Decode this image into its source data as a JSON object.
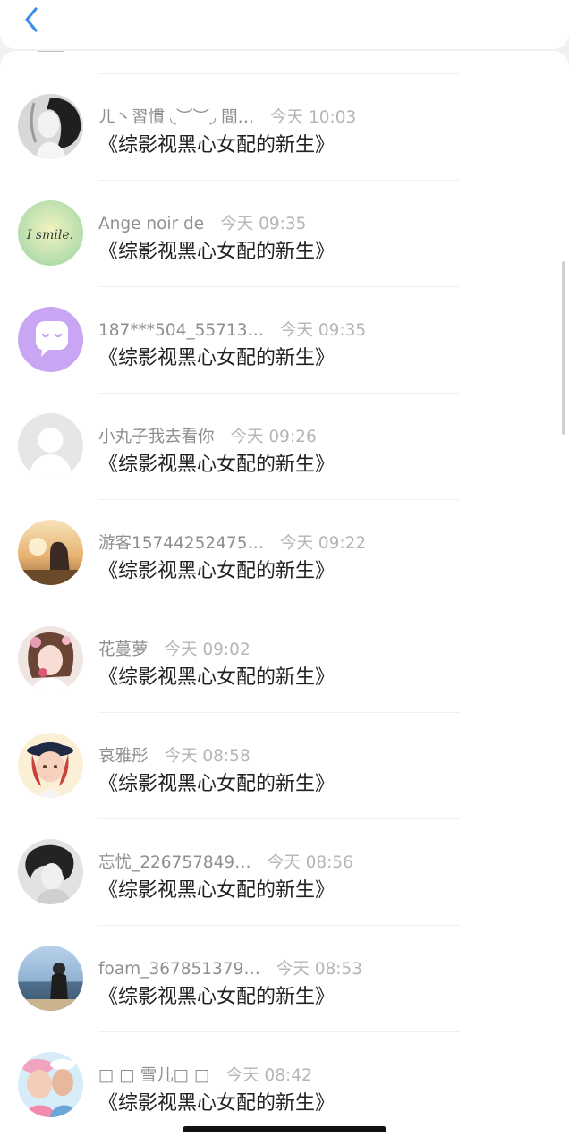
{
  "nav": {
    "back_icon": "chevron-left-icon",
    "accent": "#3a8ee6"
  },
  "comments": [
    {
      "name": "ㄦ丶習慣 ◟︶︶◞ 間…",
      "time": "今天 10:03",
      "text": "《综影视黑心女配的新生》"
    },
    {
      "name": "Ange noir de",
      "time": "今天 09:35",
      "text": "《综影视黑心女配的新生》"
    },
    {
      "name": "187***504_55713…",
      "time": "今天 09:35",
      "text": "《综影视黑心女配的新生》"
    },
    {
      "name": "小丸子我去看你",
      "time": "今天 09:26",
      "text": "《综影视黑心女配的新生》"
    },
    {
      "name": "游客15744252475…",
      "time": "今天 09:22",
      "text": "《综影视黑心女配的新生》"
    },
    {
      "name": "花蔓萝",
      "time": "今天 09:02",
      "text": "《综影视黑心女配的新生》"
    },
    {
      "name": "哀雅彤",
      "time": "今天 08:58",
      "text": "《综影视黑心女配的新生》"
    },
    {
      "name": "忘忧_226757849…",
      "time": "今天 08:56",
      "text": "《综影视黑心女配的新生》"
    },
    {
      "name": "foam_367851379…",
      "time": "今天 08:53",
      "text": "《综影视黑心女配的新生》"
    },
    {
      "name": "□ □  雪儿□  □",
      "time": "今天 08:42",
      "text": "《综影视黑心女配的新生》"
    }
  ]
}
